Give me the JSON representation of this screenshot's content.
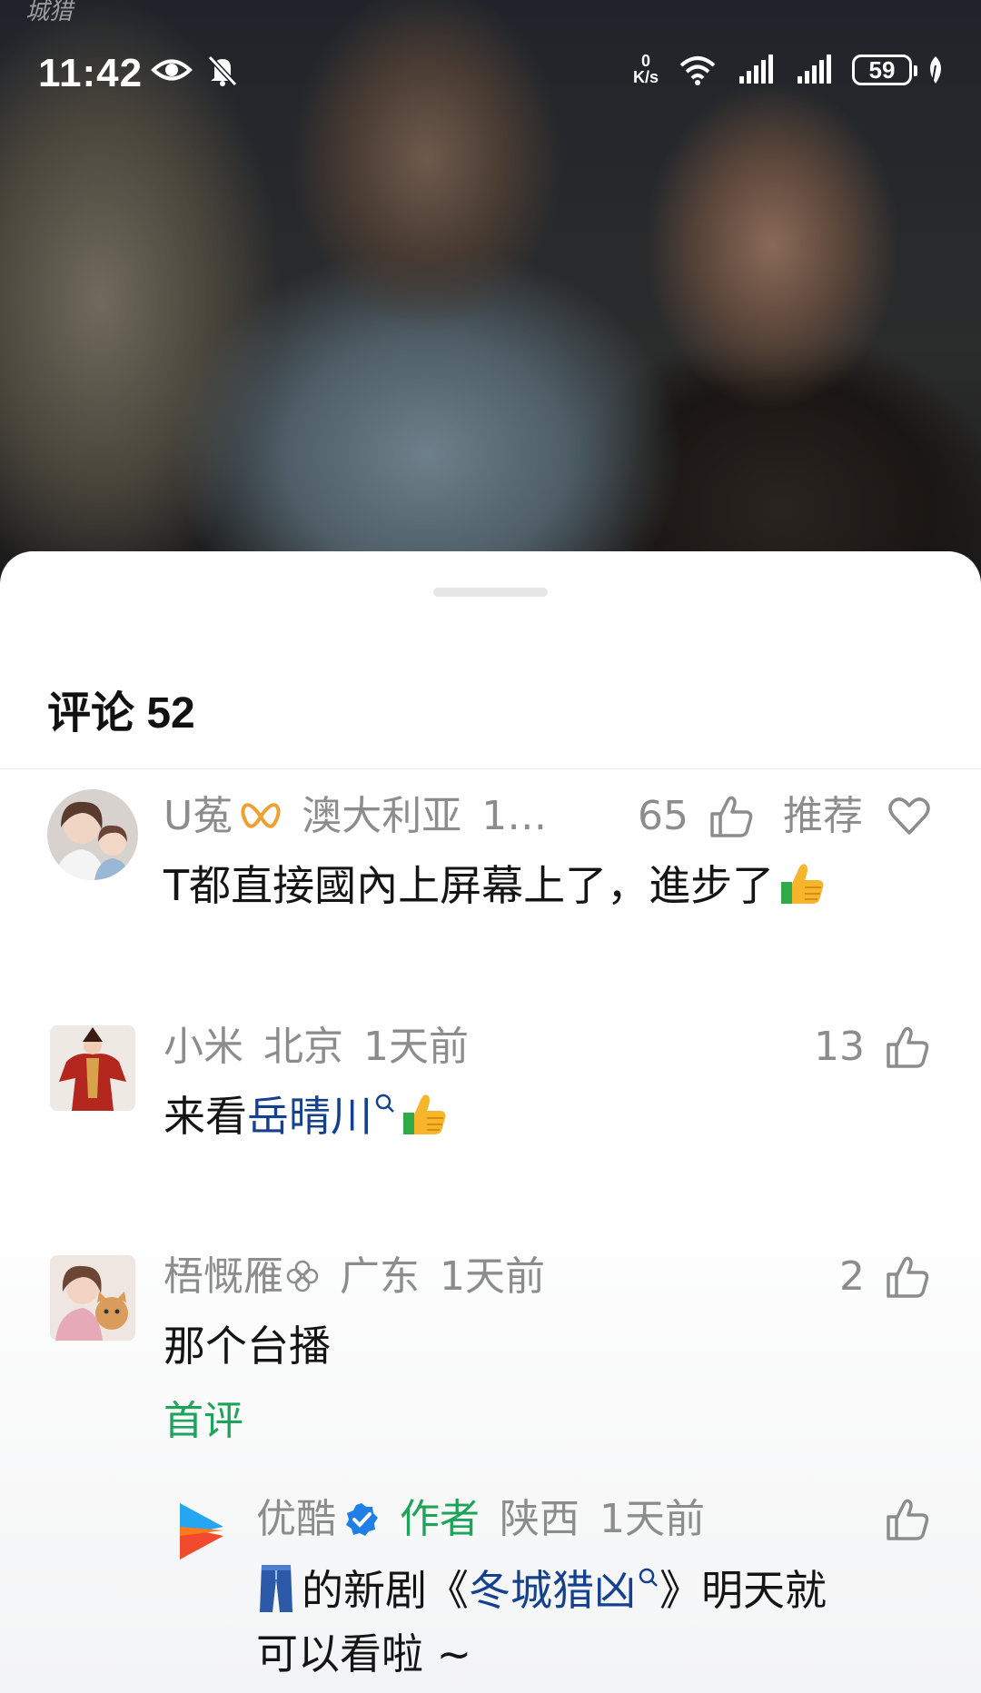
{
  "status_bar": {
    "time": "11:42",
    "net_speed_value": "0",
    "net_speed_unit": "K/s",
    "battery": "59",
    "icons": [
      "eye-icon",
      "mute-bell-icon",
      "wifi-icon",
      "signal-icon",
      "signal-icon",
      "leaf-icon"
    ]
  },
  "video": {
    "watermark": "城猎"
  },
  "comments_panel": {
    "title": "评论 52",
    "comments": [
      {
        "user": "U菟",
        "location": "澳大利亚",
        "time": "1…",
        "likes": "65",
        "extra_label": "推荐",
        "text": "T都直接國內上屏幕上了，進步了"
      },
      {
        "user": "小米",
        "location": "北京",
        "time": "1天前",
        "likes": "13",
        "text_prefix": "来看",
        "text_link": "岳晴川"
      },
      {
        "user": "梧慨雁",
        "location": "广东",
        "time": "1天前",
        "likes": "2",
        "text": "那个台播",
        "tag": "首评"
      }
    ],
    "reply": {
      "user": "优酷",
      "role": "作者",
      "location": "陕西",
      "time": "1天前",
      "text_part1": "的新剧《",
      "text_link": "冬城猎凶",
      "text_part2": "》明天就",
      "text_line2": "可以看啦 ~"
    }
  }
}
